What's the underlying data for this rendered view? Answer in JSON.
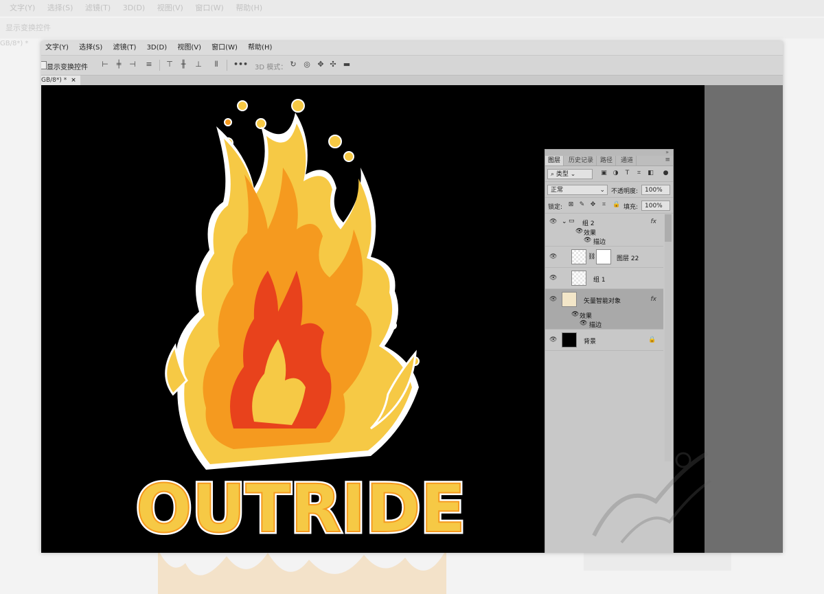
{
  "ghost": {
    "menu": [
      "文字(Y)",
      "选择(S)",
      "滤镜(T)",
      "3D(D)",
      "视图(V)",
      "窗口(W)",
      "帮助(H)"
    ],
    "options_label": "显示变换控件",
    "tab_label": "GB/8*) *"
  },
  "menu": [
    "文字(Y)",
    "选择(S)",
    "滤镜(T)",
    "3D(D)",
    "视图(V)",
    "窗口(W)",
    "帮助(H)"
  ],
  "options": {
    "transform_label": "显示变换控件",
    "mode_3d": "3D 模式：",
    "more": "•••"
  },
  "doc_tab": {
    "label": "GB/8*) *",
    "close": "×"
  },
  "artwork": {
    "text": "OUTRIDE"
  },
  "panel": {
    "tabs": [
      "图层",
      "历史记录",
      "路径",
      "通道"
    ],
    "filter_kind": "类型",
    "blend_mode": "正常",
    "opacity_label": "不透明度:",
    "opacity_value": "100%",
    "lock_label": "锁定:",
    "fill_label": "填充:",
    "fill_value": "100%",
    "layers": {
      "group2": {
        "name": "组 2",
        "fx": "fx",
        "effects": "效果",
        "stroke": "描边"
      },
      "layer22": {
        "name": "图层 22"
      },
      "group1": {
        "name": "组 1"
      },
      "smart": {
        "name": "矢量智能对象",
        "fx": "fx",
        "effects": "效果",
        "stroke": "描边"
      },
      "background": {
        "name": "背景"
      }
    },
    "bottom_icons": [
      "link-icon",
      "fx-icon",
      "mask-icon",
      "adjustment-icon",
      "folder-icon",
      "new-layer-icon",
      "trash-icon"
    ]
  },
  "colors": {
    "canvas": "#000000",
    "flame_outer": "#f6c945",
    "flame_mid": "#f59a1f",
    "flame_inner": "#e8421c",
    "panel": "#c8c8c8"
  }
}
